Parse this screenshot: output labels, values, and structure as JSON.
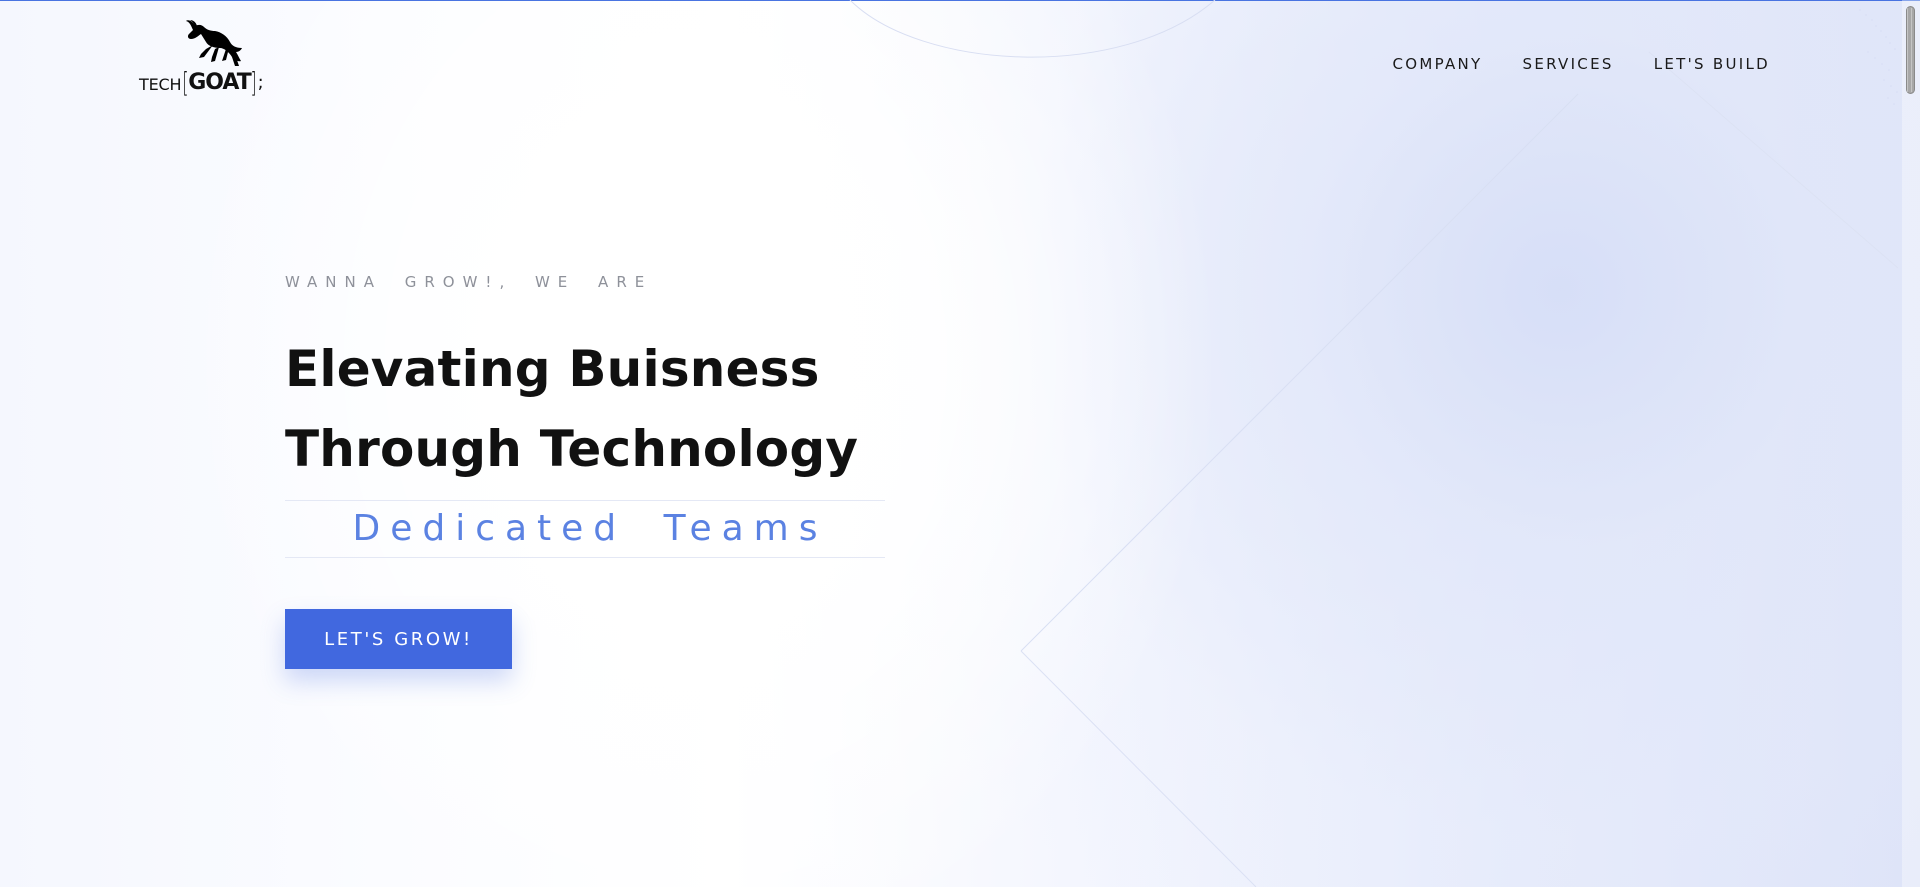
{
  "brand": {
    "logo_tech": "TECH",
    "logo_left_bracket": "[",
    "logo_goat": "GOAT",
    "logo_right_bracket": "]",
    "logo_semicolon": ";",
    "logo_icon": "goat-icon"
  },
  "navigation": {
    "items": [
      {
        "label": "COMPANY"
      },
      {
        "label": "SERVICES"
      },
      {
        "label": "LET'S BUILD"
      }
    ]
  },
  "hero": {
    "eyebrow": "WANNA GROW!, WE ARE",
    "title_line_1": "Elevating Buisness",
    "title_line_2": "Through Technology",
    "rotating_text": "Dedicated Teams",
    "cta_label": "LET'S GROW!"
  },
  "theme": {
    "accent": "#4168df",
    "accent_light": "#5b82e2",
    "text_dark": "#111111",
    "muted_text": "#8e919a",
    "top_rule": "#3f6ddf"
  },
  "scrollbar": {
    "icon": "vertical-scrollbar"
  }
}
